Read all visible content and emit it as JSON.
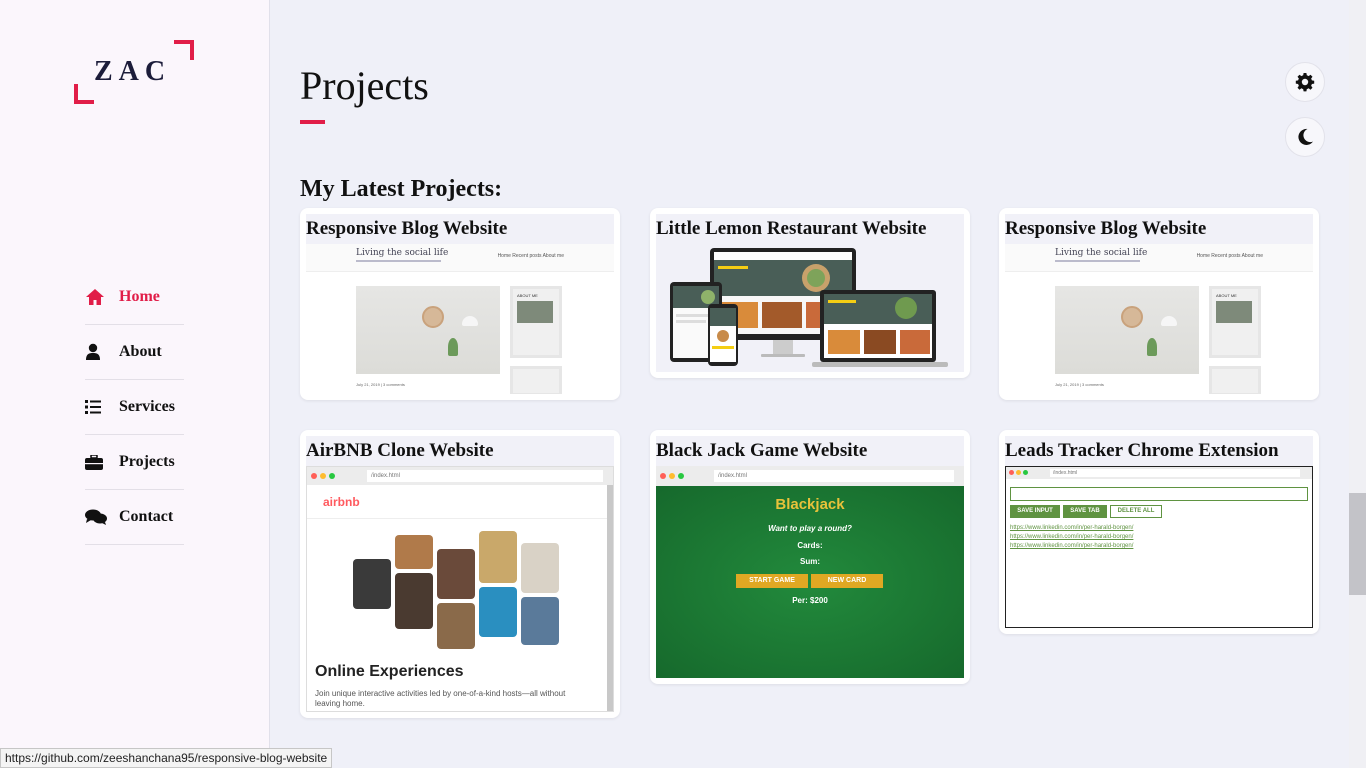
{
  "logo": {
    "text": "ZAC"
  },
  "nav": {
    "items": [
      {
        "label": "Home",
        "icon": "home-icon",
        "active": true
      },
      {
        "label": "About",
        "icon": "user-icon",
        "active": false
      },
      {
        "label": "Services",
        "icon": "list-icon",
        "active": false
      },
      {
        "label": "Projects",
        "icon": "briefcase-icon",
        "active": false
      },
      {
        "label": "Contact",
        "icon": "comments-icon",
        "active": false
      }
    ]
  },
  "page": {
    "title": "Projects",
    "section_heading": "My Latest Projects:"
  },
  "projects": [
    {
      "title": "Responsive Blog Website",
      "thumb": "blog"
    },
    {
      "title": "Little Lemon Restaurant Website",
      "thumb": "restaurant"
    },
    {
      "title": "Responsive Blog Website",
      "thumb": "blog"
    },
    {
      "title": "AirBNB Clone Website",
      "thumb": "airbnb"
    },
    {
      "title": "Black Jack Game Website",
      "thumb": "blackjack"
    },
    {
      "title": "Leads Tracker Chrome Extension",
      "thumb": "leads"
    }
  ],
  "thumbs": {
    "blog": {
      "site_title": "Living the social life",
      "nav_text": "Home    Recent posts    About me",
      "about": "ABOUT ME",
      "meta": "July 21, 2019 | 3 comments"
    },
    "airbnb": {
      "url": "/index.html",
      "brand": "airbnb",
      "headline": "Online Experiences",
      "sub": "Join unique interactive activities led by one-of-a-kind hosts—all without leaving home."
    },
    "blackjack": {
      "url": "/index.html",
      "heading": "Blackjack",
      "prompt": "Want to play a round?",
      "cards": "Cards:",
      "sum": "Sum:",
      "start": "START GAME",
      "new_card": "NEW CARD",
      "player": "Per: $200"
    },
    "leads": {
      "url": "/index.html",
      "save_input": "SAVE INPUT",
      "save_tab": "SAVE TAB",
      "delete_all": "DELETE ALL",
      "links": [
        "https://www.linkedin.com/in/per-harald-borgen/",
        "https://www.linkedin.com/in/per-harald-borgen/",
        "https://www.linkedin.com/in/per-harald-borgen/"
      ]
    }
  },
  "controls": {
    "settings_icon": "gear-icon",
    "theme_icon": "moon-icon"
  },
  "status_bar": {
    "url": "https://github.com/zeeshanchana95/responsive-blog-website"
  },
  "colors": {
    "accent": "#e11d48",
    "background": "#eff0f8",
    "sidebar": "#fbf6fc"
  }
}
